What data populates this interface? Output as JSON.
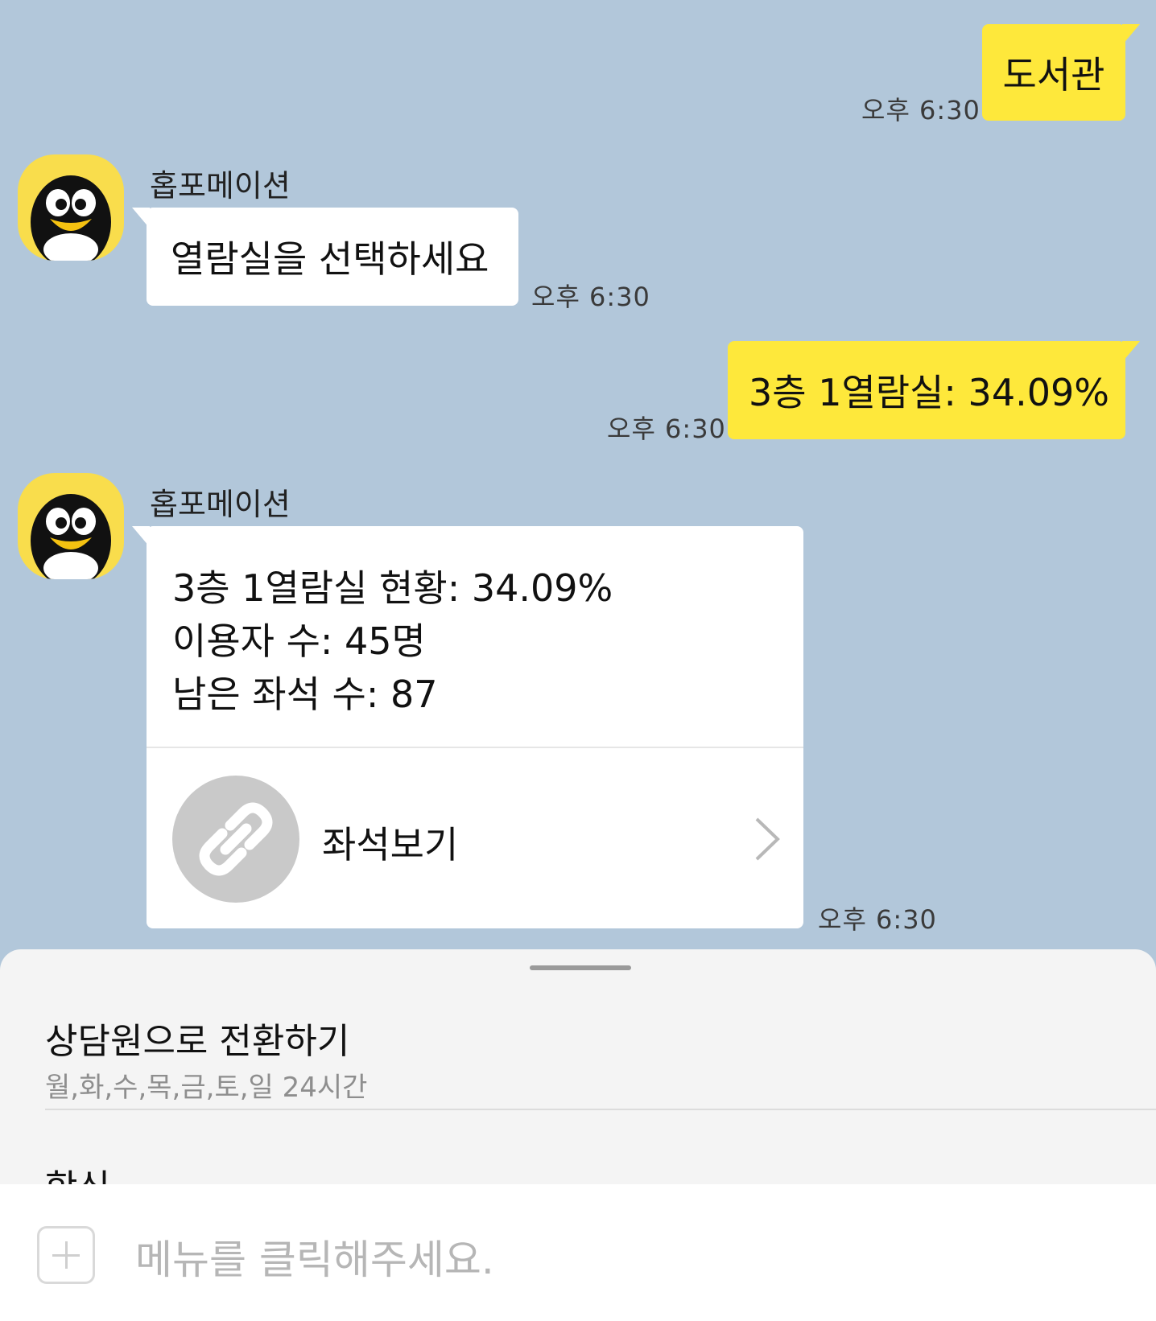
{
  "messages": {
    "m1": {
      "text": "도서관",
      "time": "오후 6:30"
    },
    "m2": {
      "sender": "홉포메이션",
      "text": "열람실을 선택하세요",
      "time": "오후 6:30"
    },
    "m3": {
      "text": "3층 1열람실: 34.09%",
      "time": "오후 6:30"
    },
    "m4": {
      "sender": "홉포메이션",
      "lines": [
        "3층 1열람실 현황: 34.09%",
        "이용자 수: 45명",
        "남은 좌석 수: 87"
      ],
      "link_label": "좌석보기",
      "time": "오후 6:30"
    }
  },
  "menu_sheet": {
    "options": [
      {
        "title": "상담원으로 전환하기",
        "subtitle": "월,화,수,목,금,토,일 24시간"
      },
      {
        "title": "학식"
      }
    ]
  },
  "input": {
    "placeholder": "메뉴를 클릭해주세요."
  },
  "icons": {
    "avatar": "penguin-avatar-icon",
    "link": "link-icon",
    "chevron": "chevron-right-icon",
    "plus": "plus-icon"
  },
  "colors": {
    "background": "#b2c7da",
    "my_bubble": "#fee83b",
    "bot_bubble": "#ffffff",
    "avatar_bg": "#f9dd4c"
  }
}
